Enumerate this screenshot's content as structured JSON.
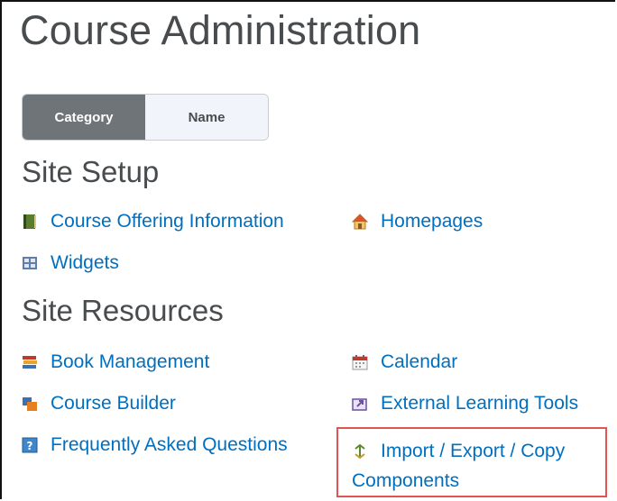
{
  "page": {
    "title": "Course Administration"
  },
  "view_toggle": {
    "category_label": "Category",
    "name_label": "Name",
    "selected": "Category"
  },
  "site_setup": {
    "heading": "Site Setup",
    "items": [
      {
        "label": "Course Offering Information",
        "icon": "book-icon"
      },
      {
        "label": "Homepages",
        "icon": "home-icon"
      },
      {
        "label": "Widgets",
        "icon": "widgets-icon"
      }
    ]
  },
  "site_resources": {
    "heading": "Site Resources",
    "items": [
      {
        "label": "Book Management",
        "icon": "books-stack-icon"
      },
      {
        "label": "Calendar",
        "icon": "calendar-icon"
      },
      {
        "label": "Course Builder",
        "icon": "course-builder-icon"
      },
      {
        "label": "External Learning Tools",
        "icon": "external-tools-icon"
      },
      {
        "label": "Frequently Asked Questions",
        "icon": "faq-icon"
      },
      {
        "label_line1": "Import / Export / Copy",
        "label_line2": "Components",
        "icon": "import-export-icon"
      }
    ]
  },
  "colors": {
    "link": "#006fbf",
    "heading": "#494c4e",
    "highlight": "#e05554",
    "toggle_active": "#6e7477"
  }
}
